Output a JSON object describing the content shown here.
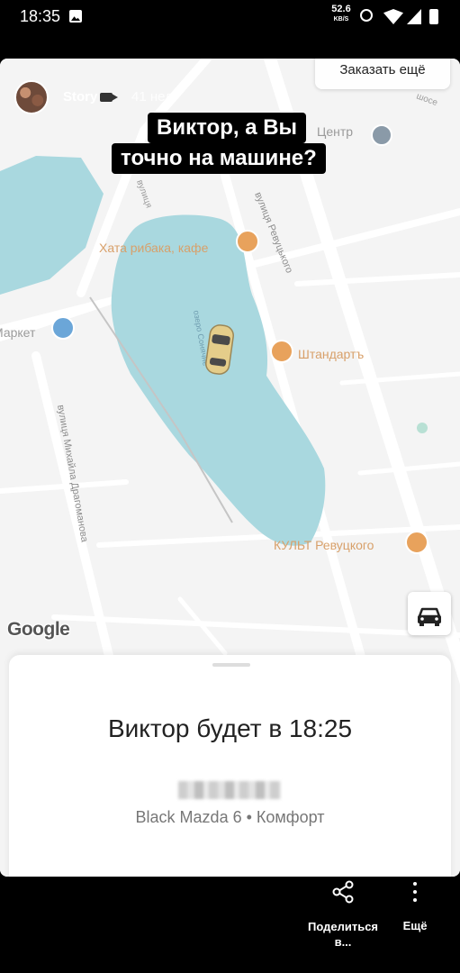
{
  "status_bar": {
    "time": "18:35",
    "net_speed_value": "52.6",
    "net_speed_unit": "KB/S"
  },
  "story": {
    "user": "Story",
    "time_ago": "41 нед",
    "caption_line1": "Виктор, а Вы",
    "caption_line2": "точно на машине?"
  },
  "map": {
    "order_more_label": "Заказать ещё",
    "labels": {
      "shose": "шосе",
      "center": "Центр",
      "khata": "Хата рибака, кафе",
      "street_revutskoho": "вулиця Ревуцького",
      "market": "Маркет",
      "lake": "озеро Сонячне",
      "shtandart": "Штандартъ",
      "street_drahomanova": "вулиця Михайла Драгоманова",
      "kult": "КУЛЬТ Ревуцкого",
      "street_top": "вулиця"
    },
    "google_logo": "Google",
    "colors": {
      "water": "#a9d8df",
      "land": "#f4f4f4",
      "road": "#ffffff",
      "poi": "#e8a25c",
      "poi_blue": "#6ba6d8"
    }
  },
  "sheet": {
    "eta": "Виктор будет в 18:25",
    "car_info": "Black Mazda 6 • Комфорт"
  },
  "bottom_bar": {
    "share_label": "Поделиться в...",
    "more_label": "Ещё"
  }
}
